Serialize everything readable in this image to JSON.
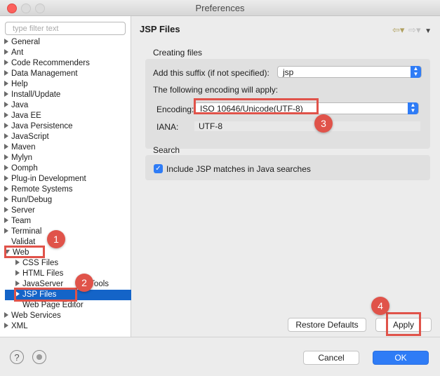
{
  "window": {
    "title": "Preferences"
  },
  "filter": {
    "placeholder": "type filter text"
  },
  "tree": [
    {
      "label": "General",
      "expanded": false
    },
    {
      "label": "Ant",
      "expanded": false
    },
    {
      "label": "Code Recommenders",
      "expanded": false
    },
    {
      "label": "Data Management",
      "expanded": false
    },
    {
      "label": "Help",
      "expanded": false
    },
    {
      "label": "Install/Update",
      "expanded": false
    },
    {
      "label": "Java",
      "expanded": false
    },
    {
      "label": "Java EE",
      "expanded": false
    },
    {
      "label": "Java Persistence",
      "expanded": false
    },
    {
      "label": "JavaScript",
      "expanded": false
    },
    {
      "label": "Maven",
      "expanded": false
    },
    {
      "label": "Mylyn",
      "expanded": false
    },
    {
      "label": "Oomph",
      "expanded": false
    },
    {
      "label": "Plug-in Development",
      "expanded": false
    },
    {
      "label": "Remote Systems",
      "expanded": false
    },
    {
      "label": "Run/Debug",
      "expanded": false
    },
    {
      "label": "Server",
      "expanded": false
    },
    {
      "label": "Team",
      "expanded": false
    },
    {
      "label": "Terminal",
      "expanded": false
    },
    {
      "label": "Validat",
      "expanded": null
    },
    {
      "label": "Web",
      "expanded": true
    },
    {
      "label": "CSS Files",
      "expanded": false,
      "child": true
    },
    {
      "label": "HTML Files",
      "expanded": false,
      "child": true
    },
    {
      "label": "JavaServer",
      "suffix": "Tools",
      "expanded": false,
      "child": true
    },
    {
      "label": "JSP Files",
      "expanded": false,
      "child": true,
      "selected": true
    },
    {
      "label": "Web Page Editor",
      "expanded": null,
      "child": true
    },
    {
      "label": "Web Services",
      "expanded": false
    },
    {
      "label": "XML",
      "expanded": false
    }
  ],
  "page": {
    "title": "JSP Files",
    "creating_files": {
      "title": "Creating files",
      "suffix_label": "Add this suffix (if not specified):",
      "suffix_value": "jsp",
      "encoding_note": "The following encoding will apply:",
      "encoding_label": "Encoding:",
      "encoding_value": "ISO 10646/Unicode(UTF-8)",
      "iana_label": "IANA:",
      "iana_value": "UTF-8"
    },
    "search": {
      "title": "Search",
      "include_label": "Include JSP matches in Java searches",
      "include_checked": true
    },
    "restore_defaults": "Restore Defaults",
    "apply": "Apply"
  },
  "footer": {
    "cancel": "Cancel",
    "ok": "OK"
  },
  "callouts": [
    "1",
    "2",
    "3",
    "4"
  ],
  "colors": {
    "accent": "#2f7cf6",
    "selection": "#1464c8",
    "callout": "#e0534a"
  }
}
